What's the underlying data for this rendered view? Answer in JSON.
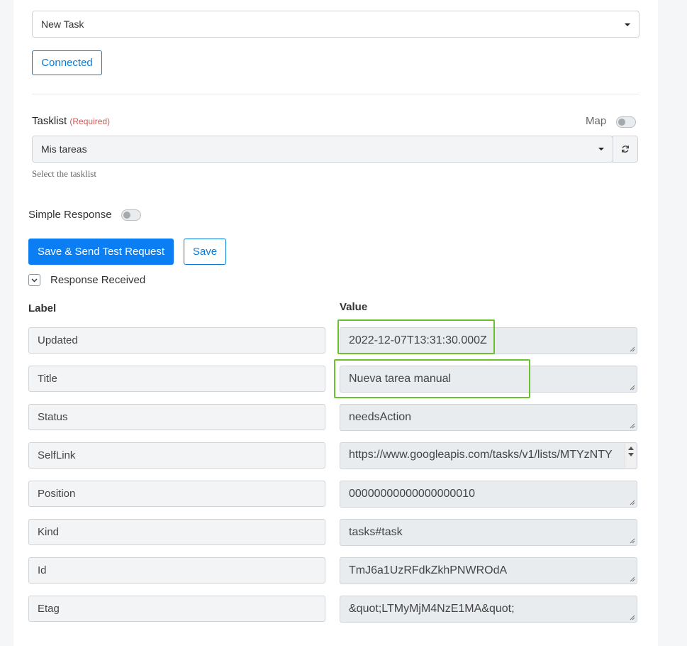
{
  "trigger": {
    "selected": "New Task"
  },
  "account": {
    "connected_label": "Connected"
  },
  "tasklist": {
    "label": "Tasklist",
    "required": "(Required)",
    "map_label": "Map",
    "selected": "Mis tareas",
    "help": "Select the tasklist"
  },
  "simple_response": {
    "label": "Simple Response"
  },
  "actions": {
    "send_test": "Save & Send Test Request",
    "save": "Save"
  },
  "response": {
    "toggle_label": "Response Received",
    "headers": {
      "label": "Label",
      "value": "Value"
    },
    "rows": [
      {
        "label": "Updated",
        "value": "2022-12-07T13:31:30.000Z"
      },
      {
        "label": "Title",
        "value": "Nueva tarea manual"
      },
      {
        "label": "Status",
        "value": "needsAction"
      },
      {
        "label": "SelfLink",
        "value": "https://www.googleapis.com/tasks/v1/lists/MTYzNTY"
      },
      {
        "label": "Position",
        "value": "00000000000000000010"
      },
      {
        "label": "Kind",
        "value": "tasks#task"
      },
      {
        "label": "Id",
        "value": "TmJ6a1UzRFdkZkhPNWROdA"
      },
      {
        "label": "Etag",
        "value": "&quot;LTMyMjM4NzE1MA&quot;"
      }
    ]
  },
  "colors": {
    "accent": "#0a7ef2",
    "highlight": "#6cc12f",
    "required": "#d9534f"
  }
}
